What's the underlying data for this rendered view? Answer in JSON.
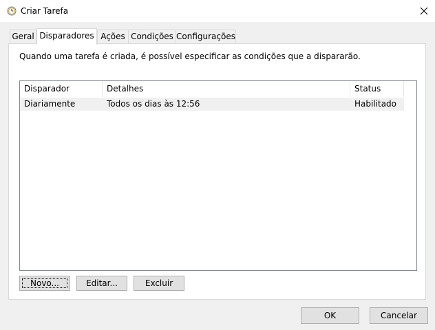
{
  "window": {
    "title": "Criar Tarefa",
    "icon": "task-scheduler-clock-icon",
    "close_glyph": "✕"
  },
  "tabs": [
    {
      "label": "Geral",
      "active": false
    },
    {
      "label": "Disparadores",
      "active": true
    },
    {
      "label": "Ações",
      "active": false
    },
    {
      "label": "Condições",
      "active": false
    },
    {
      "label": "Configurações",
      "active": false
    }
  ],
  "triggers": {
    "description": "Quando uma tarefa é criada, é possível especificar as condições que a dispararão.",
    "columns": [
      "Disparador",
      "Detalhes",
      "Status"
    ],
    "rows": [
      {
        "trigger": "Diariamente",
        "details": "Todos os dias às 12:56",
        "status": "Habilitado"
      }
    ],
    "buttons": {
      "new": "Novo...",
      "edit": "Editar...",
      "delete": "Excluir"
    }
  },
  "footer": {
    "ok": "OK",
    "cancel": "Cancelar"
  },
  "colors": {
    "accent": "#0078d7",
    "window_bg": "#f0f0f0",
    "panel_bg": "#ffffff"
  }
}
